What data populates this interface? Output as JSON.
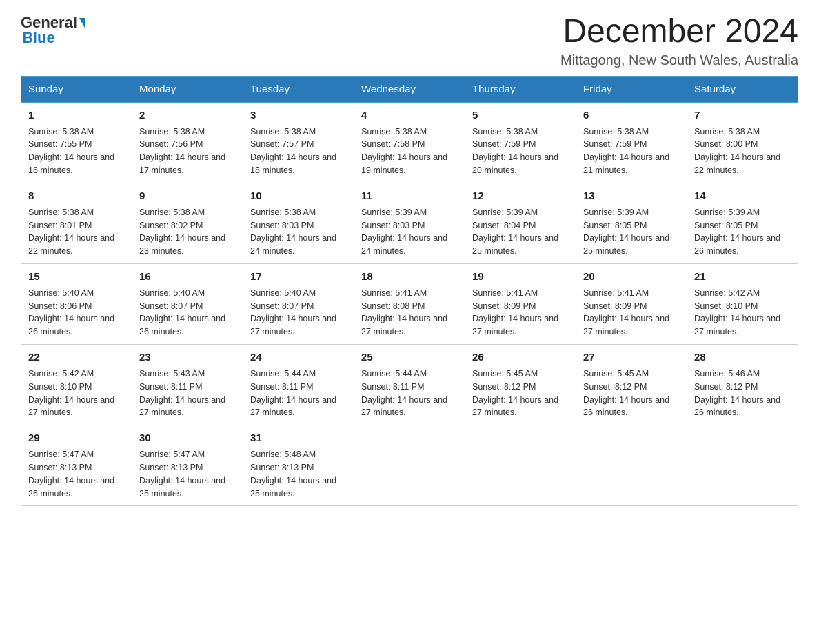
{
  "header": {
    "month_title": "December 2024",
    "location": "Mittagong, New South Wales, Australia",
    "logo_general": "General",
    "logo_blue": "Blue"
  },
  "days_of_week": [
    "Sunday",
    "Monday",
    "Tuesday",
    "Wednesday",
    "Thursday",
    "Friday",
    "Saturday"
  ],
  "weeks": [
    [
      {
        "day": "1",
        "sunrise": "5:38 AM",
        "sunset": "7:55 PM",
        "daylight": "14 hours and 16 minutes."
      },
      {
        "day": "2",
        "sunrise": "5:38 AM",
        "sunset": "7:56 PM",
        "daylight": "14 hours and 17 minutes."
      },
      {
        "day": "3",
        "sunrise": "5:38 AM",
        "sunset": "7:57 PM",
        "daylight": "14 hours and 18 minutes."
      },
      {
        "day": "4",
        "sunrise": "5:38 AM",
        "sunset": "7:58 PM",
        "daylight": "14 hours and 19 minutes."
      },
      {
        "day": "5",
        "sunrise": "5:38 AM",
        "sunset": "7:59 PM",
        "daylight": "14 hours and 20 minutes."
      },
      {
        "day": "6",
        "sunrise": "5:38 AM",
        "sunset": "7:59 PM",
        "daylight": "14 hours and 21 minutes."
      },
      {
        "day": "7",
        "sunrise": "5:38 AM",
        "sunset": "8:00 PM",
        "daylight": "14 hours and 22 minutes."
      }
    ],
    [
      {
        "day": "8",
        "sunrise": "5:38 AM",
        "sunset": "8:01 PM",
        "daylight": "14 hours and 22 minutes."
      },
      {
        "day": "9",
        "sunrise": "5:38 AM",
        "sunset": "8:02 PM",
        "daylight": "14 hours and 23 minutes."
      },
      {
        "day": "10",
        "sunrise": "5:38 AM",
        "sunset": "8:03 PM",
        "daylight": "14 hours and 24 minutes."
      },
      {
        "day": "11",
        "sunrise": "5:39 AM",
        "sunset": "8:03 PM",
        "daylight": "14 hours and 24 minutes."
      },
      {
        "day": "12",
        "sunrise": "5:39 AM",
        "sunset": "8:04 PM",
        "daylight": "14 hours and 25 minutes."
      },
      {
        "day": "13",
        "sunrise": "5:39 AM",
        "sunset": "8:05 PM",
        "daylight": "14 hours and 25 minutes."
      },
      {
        "day": "14",
        "sunrise": "5:39 AM",
        "sunset": "8:05 PM",
        "daylight": "14 hours and 26 minutes."
      }
    ],
    [
      {
        "day": "15",
        "sunrise": "5:40 AM",
        "sunset": "8:06 PM",
        "daylight": "14 hours and 26 minutes."
      },
      {
        "day": "16",
        "sunrise": "5:40 AM",
        "sunset": "8:07 PM",
        "daylight": "14 hours and 26 minutes."
      },
      {
        "day": "17",
        "sunrise": "5:40 AM",
        "sunset": "8:07 PM",
        "daylight": "14 hours and 27 minutes."
      },
      {
        "day": "18",
        "sunrise": "5:41 AM",
        "sunset": "8:08 PM",
        "daylight": "14 hours and 27 minutes."
      },
      {
        "day": "19",
        "sunrise": "5:41 AM",
        "sunset": "8:09 PM",
        "daylight": "14 hours and 27 minutes."
      },
      {
        "day": "20",
        "sunrise": "5:41 AM",
        "sunset": "8:09 PM",
        "daylight": "14 hours and 27 minutes."
      },
      {
        "day": "21",
        "sunrise": "5:42 AM",
        "sunset": "8:10 PM",
        "daylight": "14 hours and 27 minutes."
      }
    ],
    [
      {
        "day": "22",
        "sunrise": "5:42 AM",
        "sunset": "8:10 PM",
        "daylight": "14 hours and 27 minutes."
      },
      {
        "day": "23",
        "sunrise": "5:43 AM",
        "sunset": "8:11 PM",
        "daylight": "14 hours and 27 minutes."
      },
      {
        "day": "24",
        "sunrise": "5:44 AM",
        "sunset": "8:11 PM",
        "daylight": "14 hours and 27 minutes."
      },
      {
        "day": "25",
        "sunrise": "5:44 AM",
        "sunset": "8:11 PM",
        "daylight": "14 hours and 27 minutes."
      },
      {
        "day": "26",
        "sunrise": "5:45 AM",
        "sunset": "8:12 PM",
        "daylight": "14 hours and 27 minutes."
      },
      {
        "day": "27",
        "sunrise": "5:45 AM",
        "sunset": "8:12 PM",
        "daylight": "14 hours and 26 minutes."
      },
      {
        "day": "28",
        "sunrise": "5:46 AM",
        "sunset": "8:12 PM",
        "daylight": "14 hours and 26 minutes."
      }
    ],
    [
      {
        "day": "29",
        "sunrise": "5:47 AM",
        "sunset": "8:13 PM",
        "daylight": "14 hours and 26 minutes."
      },
      {
        "day": "30",
        "sunrise": "5:47 AM",
        "sunset": "8:13 PM",
        "daylight": "14 hours and 25 minutes."
      },
      {
        "day": "31",
        "sunrise": "5:48 AM",
        "sunset": "8:13 PM",
        "daylight": "14 hours and 25 minutes."
      },
      null,
      null,
      null,
      null
    ]
  ]
}
